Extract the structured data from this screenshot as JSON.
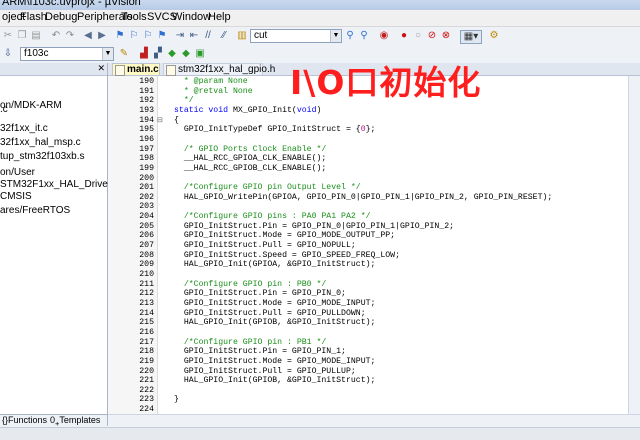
{
  "window": {
    "title": "ARM\\f103c.uvprojx - µVision"
  },
  "menu": [
    "oject",
    "Flash",
    "Debug",
    "Peripherals",
    "Tools",
    "SVCS",
    "Window",
    "Help"
  ],
  "toolbar": {
    "find_value": "cut",
    "target_value": "f103c"
  },
  "project_tree": {
    "items": [
      ".c",
      "on/MDK-ARM",
      "32f1xx_it.c",
      "32f1xx_hal_msp.c",
      "tup_stm32f103xb.s",
      "on/User",
      "STM32F1xx_HAL_Driver",
      "CMSIS",
      "ares/FreeRTOS"
    ],
    "bottom_tabs": [
      "Functions",
      "Templates"
    ]
  },
  "tabs": [
    {
      "label": "main.c",
      "active": true
    },
    {
      "label": "stm32f1xx_hal_gpio.h",
      "active": false
    }
  ],
  "overlay_text": "I\\O口初始化",
  "code_lines": [
    {
      "n": "190",
      "t": "  * @param None",
      "c": "cm"
    },
    {
      "n": "191",
      "t": "  * @retval None",
      "c": "cm"
    },
    {
      "n": "192",
      "t": "  */",
      "c": "cm"
    },
    {
      "n": "193",
      "t": "static void MX_GPIO_Init(void)",
      "c": ""
    },
    {
      "n": "194",
      "t": "{",
      "c": ""
    },
    {
      "n": "195",
      "t": "  GPIO_InitTypeDef GPIO_InitStruct = {0};",
      "c": ""
    },
    {
      "n": "196",
      "t": "",
      "c": ""
    },
    {
      "n": "197",
      "t": "  /* GPIO Ports Clock Enable */",
      "c": "cm"
    },
    {
      "n": "198",
      "t": "  __HAL_RCC_GPIOA_CLK_ENABLE();",
      "c": ""
    },
    {
      "n": "199",
      "t": "  __HAL_RCC_GPIOB_CLK_ENABLE();",
      "c": ""
    },
    {
      "n": "200",
      "t": "",
      "c": ""
    },
    {
      "n": "201",
      "t": "  /*Configure GPIO pin Output Level */",
      "c": "cm"
    },
    {
      "n": "202",
      "t": "  HAL_GPIO_WritePin(GPIOA, GPIO_PIN_0|GPIO_PIN_1|GPIO_PIN_2, GPIO_PIN_RESET);",
      "c": ""
    },
    {
      "n": "203",
      "t": "",
      "c": ""
    },
    {
      "n": "204",
      "t": "  /*Configure GPIO pins : PA0 PA1 PA2 */",
      "c": "cm"
    },
    {
      "n": "205",
      "t": "  GPIO_InitStruct.Pin = GPIO_PIN_0|GPIO_PIN_1|GPIO_PIN_2;",
      "c": ""
    },
    {
      "n": "206",
      "t": "  GPIO_InitStruct.Mode = GPIO_MODE_OUTPUT_PP;",
      "c": ""
    },
    {
      "n": "207",
      "t": "  GPIO_InitStruct.Pull = GPIO_NOPULL;",
      "c": ""
    },
    {
      "n": "208",
      "t": "  GPIO_InitStruct.Speed = GPIO_SPEED_FREQ_LOW;",
      "c": ""
    },
    {
      "n": "209",
      "t": "  HAL_GPIO_Init(GPIOA, &GPIO_InitStruct);",
      "c": ""
    },
    {
      "n": "210",
      "t": "",
      "c": ""
    },
    {
      "n": "211",
      "t": "  /*Configure GPIO pin : PB0 */",
      "c": "cm"
    },
    {
      "n": "212",
      "t": "  GPIO_InitStruct.Pin = GPIO_PIN_0;",
      "c": ""
    },
    {
      "n": "213",
      "t": "  GPIO_InitStruct.Mode = GPIO_MODE_INPUT;",
      "c": ""
    },
    {
      "n": "214",
      "t": "  GPIO_InitStruct.Pull = GPIO_PULLDOWN;",
      "c": ""
    },
    {
      "n": "215",
      "t": "  HAL_GPIO_Init(GPIOB, &GPIO_InitStruct);",
      "c": ""
    },
    {
      "n": "216",
      "t": "",
      "c": ""
    },
    {
      "n": "217",
      "t": "  /*Configure GPIO pin : PB1 */",
      "c": "cm"
    },
    {
      "n": "218",
      "t": "  GPIO_InitStruct.Pin = GPIO_PIN_1;",
      "c": ""
    },
    {
      "n": "219",
      "t": "  GPIO_InitStruct.Mode = GPIO_MODE_INPUT;",
      "c": ""
    },
    {
      "n": "220",
      "t": "  GPIO_InitStruct.Pull = GPIO_PULLUP;",
      "c": ""
    },
    {
      "n": "221",
      "t": "  HAL_GPIO_Init(GPIOB, &GPIO_InitStruct);",
      "c": ""
    },
    {
      "n": "222",
      "t": "",
      "c": ""
    },
    {
      "n": "223",
      "t": "}",
      "c": ""
    },
    {
      "n": "224",
      "t": "",
      "c": ""
    }
  ],
  "colors": {
    "comment": "#1a8f1a",
    "keyword": "#0000ff",
    "number": "#b10f8e",
    "overlay": "#ff1e1e",
    "active_tab": "#fff9c4"
  }
}
